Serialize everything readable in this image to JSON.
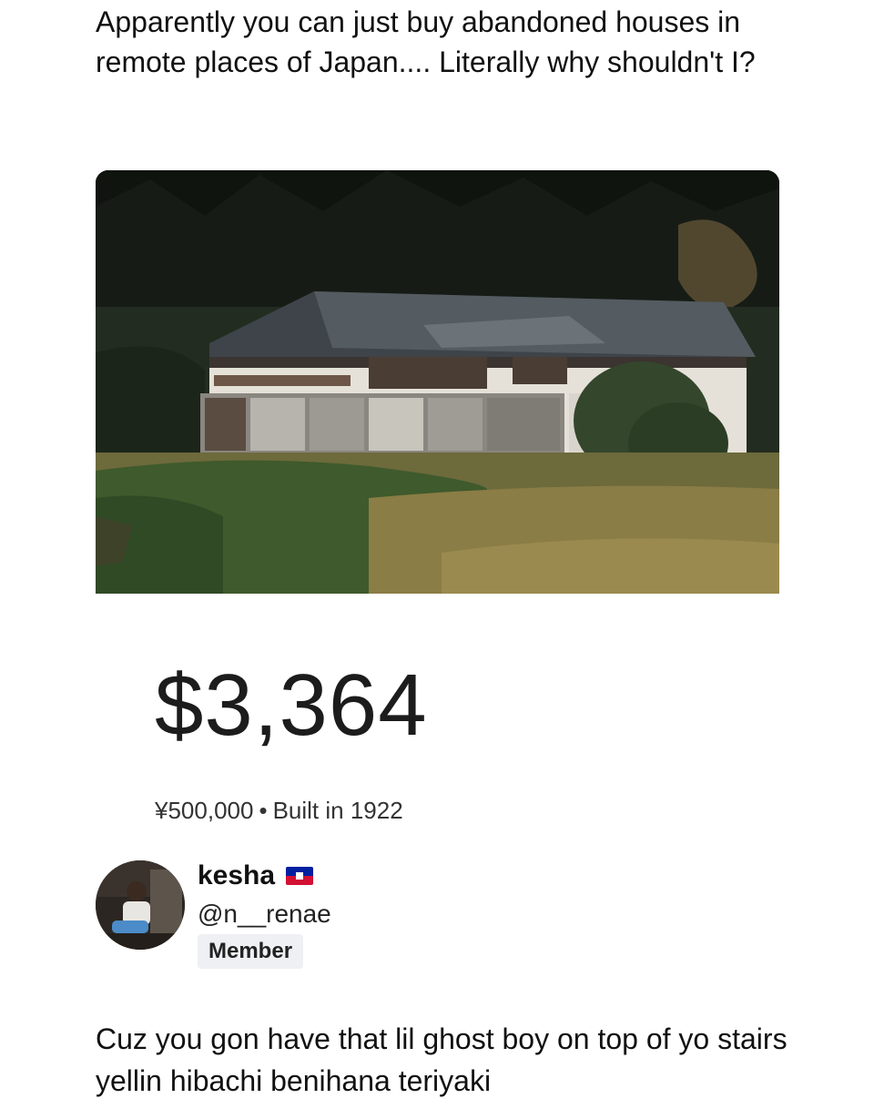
{
  "post": {
    "text": "Apparently you can just buy abandoned houses in remote places of Japan.... Literally why shouldn't I?"
  },
  "listing": {
    "price": "$3,364",
    "yen_price": "¥500,000",
    "separator": "•",
    "built": "Built in 1922"
  },
  "profile": {
    "name": "kesha",
    "handle": "@n__renae",
    "badge": "Member",
    "flag_icon": "haiti-flag-icon"
  },
  "reply": {
    "text": "Cuz you gon have that lil ghost boy on top of yo stairs yellin hibachi benihana teriyaki"
  },
  "colors": {
    "text": "#111111",
    "badge_bg": "#eef0f3",
    "flag_blue": "#00209f",
    "flag_red": "#d21034"
  }
}
